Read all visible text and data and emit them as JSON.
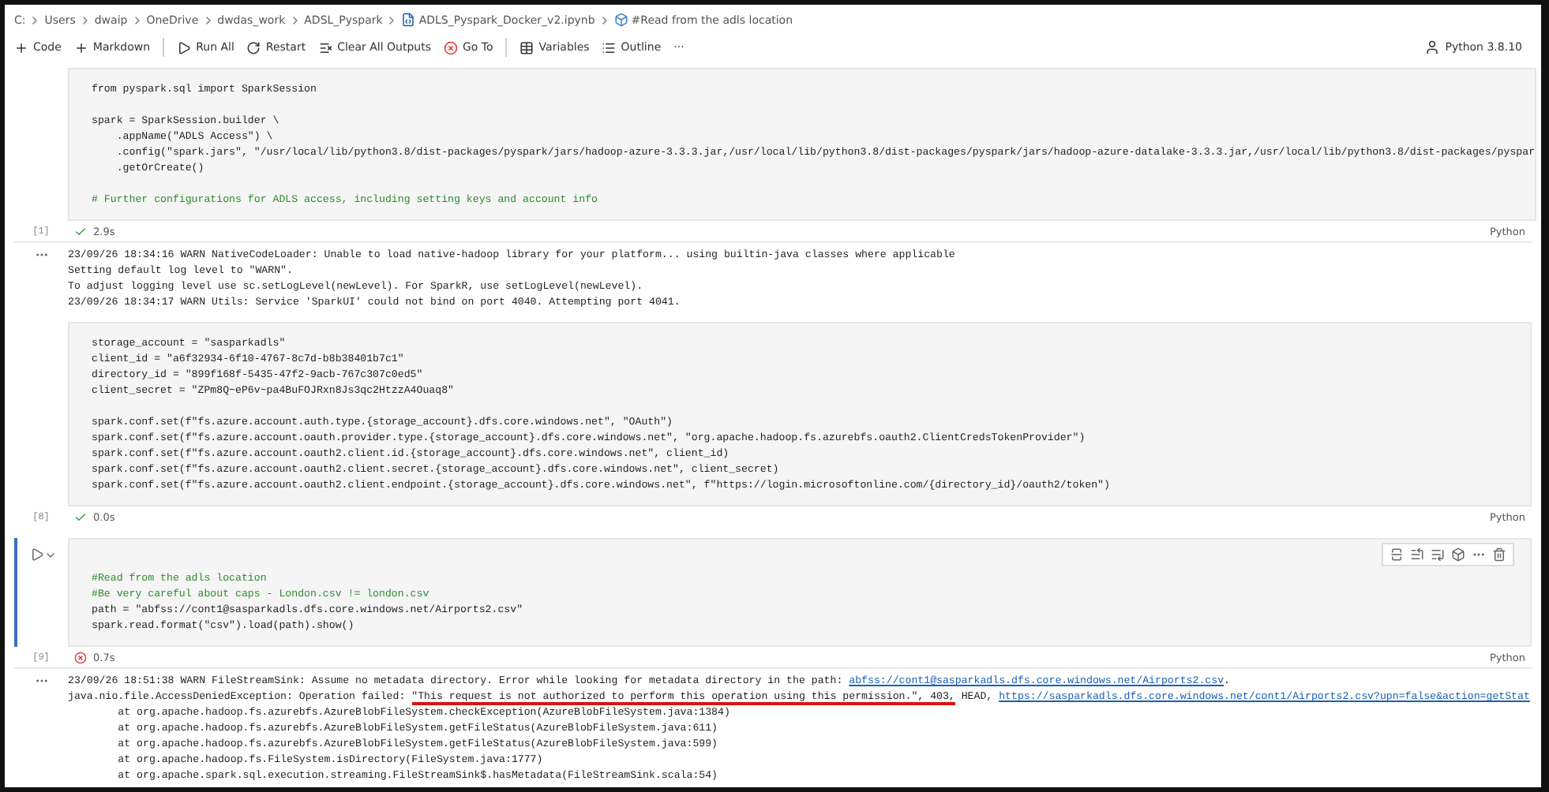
{
  "breadcrumb": [
    {
      "label": "C:",
      "kind": "text"
    },
    {
      "label": "Users",
      "kind": "text"
    },
    {
      "label": "dwaip",
      "kind": "text"
    },
    {
      "label": "OneDrive",
      "kind": "text"
    },
    {
      "label": "dwdas_work",
      "kind": "text"
    },
    {
      "label": "ADSL_Pyspark",
      "kind": "text"
    },
    {
      "label": "ADLS_Pyspark_Docker_v2.ipynb",
      "kind": "file"
    },
    {
      "label": "#Read from the adls location",
      "kind": "cell"
    }
  ],
  "toolbar": {
    "actions": [
      {
        "label": "Code"
      },
      {
        "label": "Markdown"
      },
      {
        "label": "Run All"
      },
      {
        "label": "Restart"
      },
      {
        "label": "Clear All Outputs"
      },
      {
        "label": "Go To"
      },
      {
        "label": "Variables"
      },
      {
        "label": "Outline"
      }
    ],
    "more": "···",
    "kernel": "Python 3.8.10"
  },
  "cells": [
    {
      "selected": false,
      "count": "[1]",
      "failed": false,
      "time": "2.9s",
      "language": "Python",
      "code": [
        {
          "kind": "code",
          "text": "from pyspark.sql import SparkSession"
        },
        {
          "kind": "blank"
        },
        {
          "kind": "code",
          "text": "spark = SparkSession.builder \\"
        },
        {
          "kind": "code",
          "text": "    .appName(\"ADLS Access\") \\"
        },
        {
          "kind": "code",
          "text": "    .config(\"spark.jars\", \"/usr/local/lib/python3.8/dist-packages/pyspark/jars/hadoop-azure-3.3.3.jar,/usr/local/lib/python3.8/dist-packages/pyspark/jars/hadoop-azure-datalake-3.3.3.jar,/usr/local/lib/python3.8/dist-packages/pyspar"
        },
        {
          "kind": "code",
          "text": "    .getOrCreate()"
        },
        {
          "kind": "blank"
        },
        {
          "kind": "comment",
          "text": "# Further configurations for ADLS access, including setting keys and account info"
        }
      ],
      "output": [
        [
          {
            "kind": "text",
            "text": "23/09/26 18:34:16 WARN NativeCodeLoader: Unable to load native-hadoop library for your platform... using builtin-java classes where applicable"
          }
        ],
        [
          {
            "kind": "text",
            "text": "Setting default log level to \"WARN\"."
          }
        ],
        [
          {
            "kind": "text",
            "text": "To adjust logging level use sc.setLogLevel(newLevel). For SparkR, use setLogLevel(newLevel)."
          }
        ],
        [
          {
            "kind": "text",
            "text": "23/09/26 18:34:17 WARN Utils: Service 'SparkUI' could not bind on port 4040. Attempting port 4041."
          }
        ]
      ]
    },
    {
      "selected": false,
      "count": "[8]",
      "failed": false,
      "time": "0.0s",
      "language": "Python",
      "code": [
        {
          "kind": "code",
          "text": "storage_account = \"sasparkadls\""
        },
        {
          "kind": "code",
          "text": "client_id = \"a6f32934-6f10-4767-8c7d-b8b38401b7c1\""
        },
        {
          "kind": "code",
          "text": "directory_id = \"899f168f-5435-47f2-9acb-767c307c0ed5\""
        },
        {
          "kind": "code",
          "text": "client_secret = \"ZPm8Q~eP6v~pa4BuFOJRxn8Js3qc2HtzzA4Ouaq8\""
        },
        {
          "kind": "blank"
        },
        {
          "kind": "code",
          "text": "spark.conf.set(f\"fs.azure.account.auth.type.{storage_account}.dfs.core.windows.net\", \"OAuth\")"
        },
        {
          "kind": "code",
          "text": "spark.conf.set(f\"fs.azure.account.oauth.provider.type.{storage_account}.dfs.core.windows.net\", \"org.apache.hadoop.fs.azurebfs.oauth2.ClientCredsTokenProvider\")"
        },
        {
          "kind": "code",
          "text": "spark.conf.set(f\"fs.azure.account.oauth2.client.id.{storage_account}.dfs.core.windows.net\", client_id)"
        },
        {
          "kind": "code",
          "text": "spark.conf.set(f\"fs.azure.account.oauth2.client.secret.{storage_account}.dfs.core.windows.net\", client_secret)"
        },
        {
          "kind": "code",
          "text": "spark.conf.set(f\"fs.azure.account.oauth2.client.endpoint.{storage_account}.dfs.core.windows.net\", f\"https://login.microsoftonline.com/{directory_id}/oauth2/token\")"
        }
      ]
    },
    {
      "selected": true,
      "count": "[9]",
      "failed": true,
      "time": "0.7s",
      "language": "Python",
      "code": [
        {
          "kind": "comment",
          "text": "#Read from the adls location"
        },
        {
          "kind": "comment",
          "text": "#Be very careful about caps - London.csv != london.csv"
        },
        {
          "kind": "code",
          "text": "path = \"abfss://cont1@sasparkadls.dfs.core.windows.net/Airports2.csv\""
        },
        {
          "kind": "code",
          "text": "spark.read.format(\"csv\").load(path).show()"
        }
      ],
      "output": [
        [
          {
            "kind": "text",
            "text": "23/09/26 18:51:38 WARN FileStreamSink: Assume no metadata directory. Error while looking for metadata directory in the path: "
          },
          {
            "kind": "link",
            "text": "abfss://cont1@sasparkadls.dfs.core.windows.net/Airports2.csv"
          },
          {
            "kind": "text",
            "text": "."
          }
        ],
        [
          {
            "kind": "text",
            "text": "java.nio.file.AccessDeniedException: Operation failed: "
          },
          {
            "kind": "marked",
            "text": "\"This request is not authorized to perform this operation using this permission.\", 403,"
          },
          {
            "kind": "text",
            "text": " HEAD, "
          },
          {
            "kind": "link",
            "text": "https://sasparkadls.dfs.core.windows.net/cont1/Airports2.csv?upn=false&action=getStat"
          }
        ],
        [
          {
            "kind": "text",
            "text": "\tat org.apache.hadoop.fs.azurebfs.AzureBlobFileSystem.checkException(AzureBlobFileSystem.java:1384)"
          }
        ],
        [
          {
            "kind": "text",
            "text": "\tat org.apache.hadoop.fs.azurebfs.AzureBlobFileSystem.getFileStatus(AzureBlobFileSystem.java:611)"
          }
        ],
        [
          {
            "kind": "text",
            "text": "\tat org.apache.hadoop.fs.azurebfs.AzureBlobFileSystem.getFileStatus(AzureBlobFileSystem.java:599)"
          }
        ],
        [
          {
            "kind": "text",
            "text": "\tat org.apache.hadoop.fs.FileSystem.isDirectory(FileSystem.java:1777)"
          }
        ],
        [
          {
            "kind": "text",
            "text": "\tat org.apache.spark.sql.execution.streaming.FileStreamSink$.hasMetadata(FileStreamSink.scala:54)"
          }
        ]
      ]
    }
  ]
}
